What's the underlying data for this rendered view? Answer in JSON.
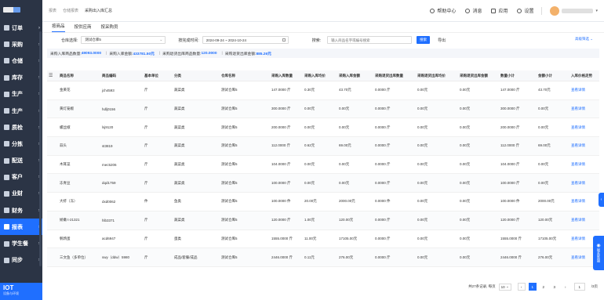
{
  "sidebar": {
    "items": [
      {
        "label": "订单",
        "active": false
      },
      {
        "label": "采购",
        "active": false
      },
      {
        "label": "仓储",
        "active": false
      },
      {
        "label": "库存",
        "active": false
      },
      {
        "label": "生产",
        "active": false
      },
      {
        "label": "生产",
        "active": false
      },
      {
        "label": "质检",
        "active": false
      },
      {
        "label": "分拣",
        "active": false
      },
      {
        "label": "配送",
        "active": false
      },
      {
        "label": "客户",
        "active": false
      },
      {
        "label": "业财",
        "active": false
      },
      {
        "label": "财务",
        "active": false
      },
      {
        "label": "报表",
        "active": true
      },
      {
        "label": "学生餐",
        "active": false
      },
      {
        "label": "同步",
        "active": false
      }
    ],
    "iot_title": "IOT",
    "iot_sub": "设备与环境"
  },
  "header": {
    "breadcrumbs": [
      "报表",
      "仓储报表",
      "采购出入库汇总"
    ],
    "help": "帮助中心",
    "messages": "消息",
    "apps": "应用",
    "settings": "设置"
  },
  "tabs": [
    "按商品",
    "按供应商",
    "按采购员"
  ],
  "filters": {
    "warehouse_label": "仓库选择:",
    "warehouse_value": "测试仓库5",
    "date_label": "按完成时间:",
    "date_value": "2024-09-24  ~  2024-10-24",
    "search_label": "搜索:",
    "search_placeholder": "输入商品名字或编号搜索",
    "search_button": "搜索",
    "export_button": "导出",
    "advanced": "高级筛选"
  },
  "summary": {
    "in_qty_label": "采购入库商品数量:",
    "in_qty": "49093.0000",
    "in_amount_label": "采购入库金额:",
    "in_amount": "433781.50元",
    "return_qty_label": "采购退货出库商品数量:",
    "return_qty": "120.0000",
    "return_amount_label": "采购退货出库金额:",
    "return_amount": "885.26元"
  },
  "table": {
    "headers": [
      "商品名称",
      "商品编码",
      "基本单位",
      "分类",
      "仓库名称",
      "采购入库数量",
      "采购入库均价",
      "采购入库金额",
      "采购退货出库数量",
      "采购退货出库均价",
      "采购退货出库金额",
      "数量小计",
      "金额小计",
      "入库价格走势"
    ],
    "rows": [
      [
        "金黄花",
        "jch4593",
        "斤",
        "蔬菜类",
        "测试仓库5",
        "147.0000 斤",
        "0.30元",
        "43.70元",
        "0.0000 斤",
        "0.00元",
        "0.00元",
        "147.0000 斤",
        "43.70元",
        "查看详情"
      ],
      [
        "黄灯笼椒",
        "hdlj0156",
        "斤",
        "蔬菜类",
        "测试仓库5",
        "300.0000 斤",
        "0.00元",
        "0.00元",
        "0.0000 斤",
        "0.00元",
        "0.00元",
        "300.0000 斤",
        "0.00元",
        "查看详情"
      ],
      [
        "螺丝椒",
        "lsj9120",
        "斤",
        "蔬菜类",
        "测试仓库5",
        "200.0000 斤",
        "0.00元",
        "0.00元",
        "0.0000 斤",
        "0.00元",
        "0.00元",
        "200.0000 斤",
        "0.00元",
        "查看详情"
      ],
      [
        "蒜头",
        "st3819",
        "斤",
        "蔬菜类",
        "测试仓库5",
        "112.0000 斤",
        "0.62元",
        "69.00元",
        "0.0000 斤",
        "0.00元",
        "0.00元",
        "112.0000 斤",
        "69.00元",
        "查看详情"
      ],
      [
        "木耳菜",
        "mec5206",
        "斤",
        "蔬菜类",
        "测试仓库5",
        "104.0000 斤",
        "0.00元",
        "0.00元",
        "0.0000 斤",
        "0.00元",
        "0.00元",
        "104.0000 斤",
        "0.00元",
        "查看详情"
      ],
      [
        "冻青豆",
        "dqd1759",
        "斤",
        "蔬菜类",
        "测试仓库5",
        "100.0000 斤",
        "0.00元",
        "0.00元",
        "0.0000 斤",
        "0.00元",
        "0.00元",
        "100.0000 斤",
        "0.00元",
        "查看详情"
      ],
      [
        "大虾（冻）",
        "dxd0062",
        "件",
        "鱼类",
        "测试仓库5",
        "100.0000 件",
        "20.00元",
        "2000.00元",
        "0.0000 件",
        "0.00元",
        "0.00元",
        "100.0000 件",
        "2000.00元",
        "查看详情"
      ],
      [
        "娇嫩 t-21321",
        "hlb3371",
        "斤",
        "蔬菜类",
        "测试仓库5",
        "120.0000 斤",
        "1.00元",
        "120.00元",
        "0.0000 斤",
        "0.00元",
        "0.00元",
        "120.0000 斤",
        "120.00元",
        "查看详情"
      ],
      [
        "鹌鹑蛋",
        "acd6947",
        "斤",
        "蛋类",
        "测试仓库5",
        "1555.0000 斤",
        "11.00元",
        "17105.00元",
        "0.0000 斤",
        "0.00元",
        "0.00元",
        "1555.0000 斤",
        "17105.00元",
        "查看详情"
      ],
      [
        "三文鱼（多单位）",
        "swy（ddw）5980",
        "斤",
        "成品/套餐/成品",
        "测试仓库5",
        "2446.0000 斤",
        "0.11元",
        "276.00元",
        "0.0000 斤",
        "0.00元",
        "0.00元",
        "2446.0000 斤",
        "276.00元",
        "查看详情"
      ]
    ]
  },
  "pagination": {
    "total": "共27条记录, 每页",
    "page_size": "10",
    "pages": [
      "1",
      "2",
      "3"
    ],
    "current": "1",
    "goto": "1",
    "total_pages": "/3页"
  },
  "float_button": "联系客服"
}
